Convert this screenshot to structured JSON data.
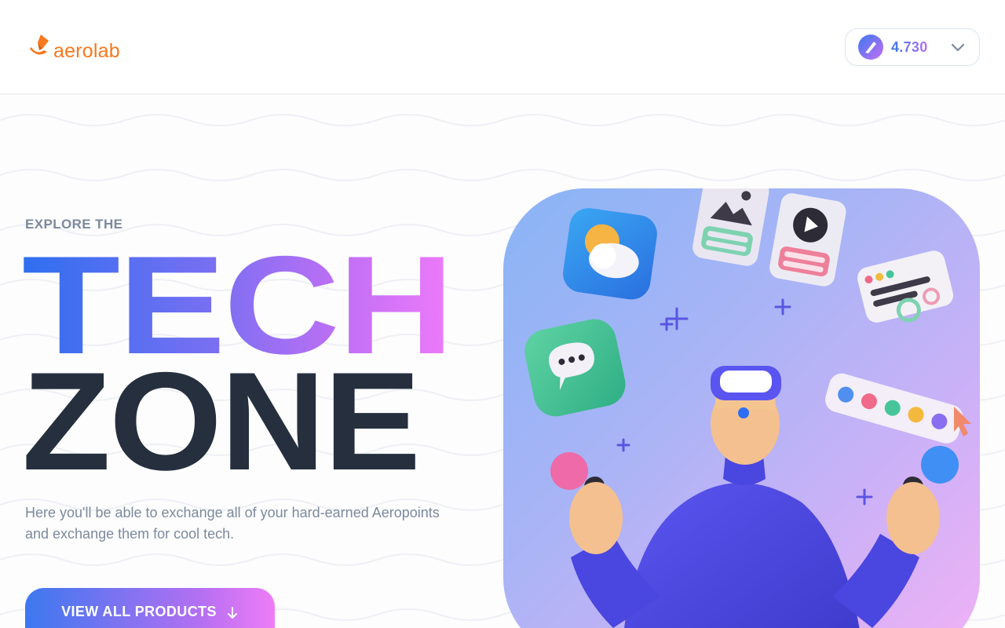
{
  "header": {
    "logo_text": "aerolab",
    "points_value": "4.730",
    "logo_color": "#f7781d"
  },
  "hero": {
    "eyebrow": "EXPLORE THE",
    "title_line1": "TECH",
    "title_line2": "ZONE",
    "subtitle": "Here you'll be able to exchange all of your hard-earned Aeropoints and exchange them for cool tech.",
    "cta_label": "VIEW ALL PRODUCTS",
    "cta_icon": "arrow-down-icon"
  },
  "colors": {
    "accent_blue": "#3c78f0",
    "accent_pink": "#ef7cf6",
    "dark_text": "#252f3d",
    "muted_text": "#7c899c"
  }
}
